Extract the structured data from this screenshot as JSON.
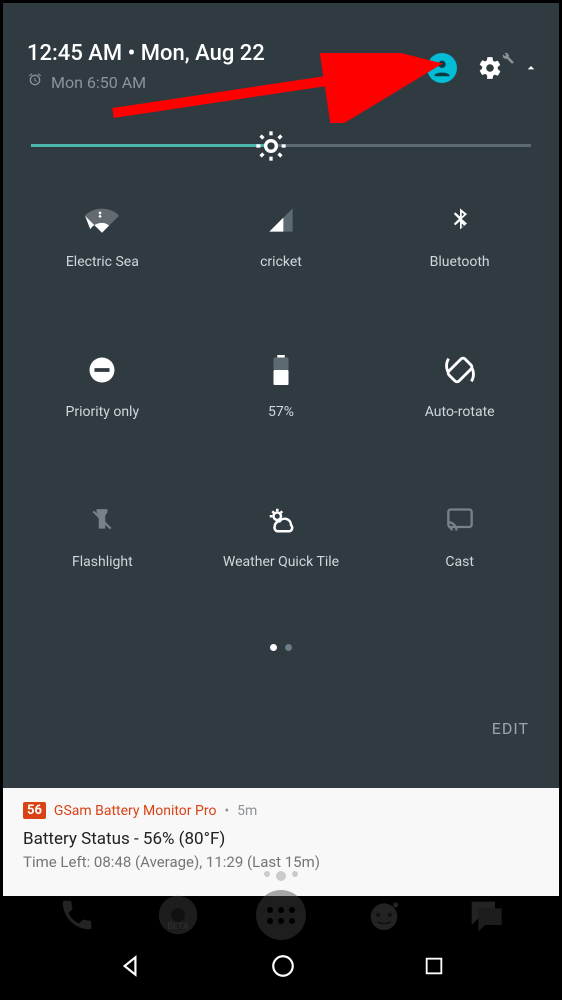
{
  "header": {
    "time": "12:45 AM",
    "date": "Mon, Aug 22",
    "alarm": "Mon 6:50 AM",
    "separator": " • "
  },
  "brightness": {
    "percent": 48
  },
  "tiles": [
    {
      "id": "wifi",
      "label": "Electric Sea"
    },
    {
      "id": "cellular",
      "label": "cricket"
    },
    {
      "id": "bluetooth",
      "label": "Bluetooth"
    },
    {
      "id": "dnd",
      "label": "Priority only"
    },
    {
      "id": "battery",
      "label": "57%"
    },
    {
      "id": "rotate",
      "label": "Auto-rotate"
    },
    {
      "id": "flashlight",
      "label": "Flashlight"
    },
    {
      "id": "weather",
      "label": "Weather Quick Tile"
    },
    {
      "id": "cast",
      "label": "Cast"
    }
  ],
  "edit_label": "EDIT",
  "notification": {
    "badge": "56",
    "app": "GSam Battery Monitor Pro",
    "time": "5m",
    "title": "Battery Status - 56% (80°F)",
    "subtitle": "Time Left: 08:48 (Average), 11:29 (Last 15m)"
  },
  "annotation": {
    "arrow_color": "#ff0000",
    "target": "settings-icon"
  }
}
